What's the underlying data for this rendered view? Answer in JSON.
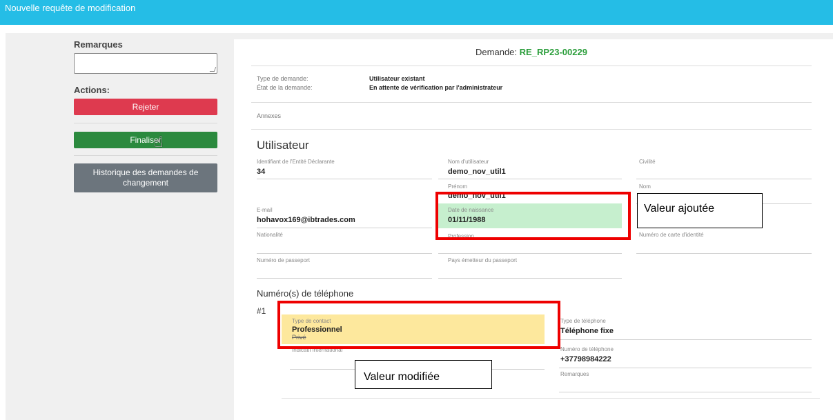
{
  "topbar": {
    "title": "Nouvelle requête de modification"
  },
  "left_panel": {
    "remarques_label": "Remarques",
    "actions_label": "Actions:",
    "reject_button": "Rejeter",
    "finalize_button": "Finaliser",
    "history_button_line1": "Historique des demandes de",
    "history_button_line2": "changement"
  },
  "demande": {
    "label": "Demande:",
    "number": "RE_RP23-00229"
  },
  "info": {
    "type_label": "Type de demande:",
    "type_value": "Utilisateur existant",
    "etat_label": "État de la demande:",
    "etat_value": "En attente de vérification par l'administrateur",
    "annexes_label": "Annexes"
  },
  "utilisateur": {
    "title": "Utilisateur",
    "fields": {
      "id_entite": {
        "label": "Identifiant de l'Entité Déclarante",
        "value": "34"
      },
      "nom_utilisateur": {
        "label": "Nom d'utilisateur",
        "value": "demo_nov_util1"
      },
      "civilite": {
        "label": "Civilité",
        "value": ""
      },
      "prenom": {
        "label": "Prénom",
        "value": "demo_nov_util1"
      },
      "nom": {
        "label": "Nom",
        "value": ""
      },
      "email": {
        "label": "E-mail",
        "value": "hohavox169@ibtrades.com"
      },
      "date_naissance": {
        "label": "Date de naissance",
        "value": "01/11/1988"
      },
      "nationalite": {
        "label": "Nationalité",
        "value": ""
      },
      "profession": {
        "label": "Profession",
        "value": ""
      },
      "carte_identite": {
        "label": "Numéro de carte d'identité",
        "value": ""
      },
      "passeport": {
        "label": "Numéro de passeport",
        "value": ""
      },
      "pays_passeport": {
        "label": "Pays émetteur du passeport",
        "value": ""
      }
    }
  },
  "telephone": {
    "title": "Numéro(s) de téléphone",
    "index": "#1",
    "type_contact": {
      "label": "Type de contact",
      "value": "Professionnel",
      "old_value": "Privé"
    },
    "indicatif": {
      "label": "Indicatif international",
      "value": ""
    },
    "type_telephone": {
      "label": "Type de téléphone",
      "value": "Téléphone fixe"
    },
    "numero": {
      "label": "Numéro de téléphone",
      "value": "+37798984222"
    },
    "remarques": {
      "label": "Remarques",
      "value": ""
    }
  },
  "annotations": {
    "added": "Valeur ajoutée",
    "modified": "Valeur modifiée"
  },
  "colors": {
    "topbar": "#25bde6",
    "reject": "#de3a4f",
    "finalize": "#2b8a3e",
    "history": "#6c757d",
    "added_highlight": "#c6efce",
    "modified_highlight": "#fde89d",
    "annotation_border": "#ee0000",
    "request_number": "#2a9d3a"
  }
}
